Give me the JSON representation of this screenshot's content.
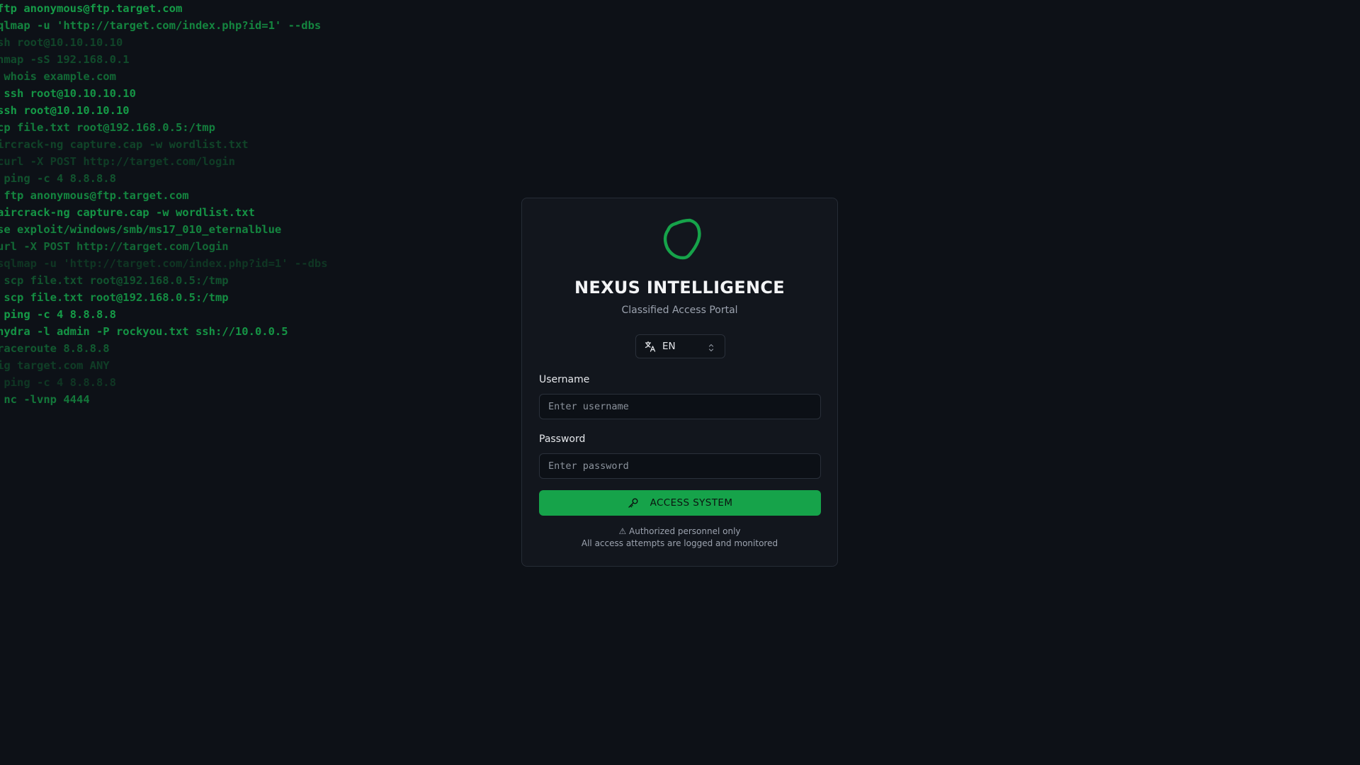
{
  "background_terminal": {
    "lines": [
      {
        "text": "ftp anonymous@ftp.target.com",
        "opacity": 0.95
      },
      {
        "text": "qlmap -u 'http://target.com/index.php?id=1' --dbs",
        "opacity": 0.8
      },
      {
        "text": "sh root@10.10.10.10",
        "opacity": 0.35
      },
      {
        "text": "nmap -sS 192.168.0.1",
        "opacity": 0.4
      },
      {
        "text": " whois example.com",
        "opacity": 0.6
      },
      {
        "text": " ssh root@10.10.10.10",
        "opacity": 0.9
      },
      {
        "text": "ssh root@10.10.10.10",
        "opacity": 0.95
      },
      {
        "text": "cp file.txt root@192.168.0.5:/tmp",
        "opacity": 0.75
      },
      {
        "text": "ircrack-ng capture.cap -w wordlist.txt",
        "opacity": 0.35
      },
      {
        "text": "curl -X POST http://target.com/login",
        "opacity": 0.3
      },
      {
        "text": " ping -c 4 8.8.8.8",
        "opacity": 0.45
      },
      {
        "text": " ftp anonymous@ftp.target.com",
        "opacity": 0.8
      },
      {
        "text": "aircrack-ng capture.cap -w wordlist.txt",
        "opacity": 0.9
      },
      {
        "text": "se exploit/windows/smb/ms17_010_eternalblue",
        "opacity": 0.8
      },
      {
        "text": "url -X POST http://target.com/login",
        "opacity": 0.6
      },
      {
        "text": "sqlmap -u 'http://target.com/index.php?id=1' --dbs",
        "opacity": 0.25
      },
      {
        "text": " scp file.txt root@192.168.0.5:/tmp",
        "opacity": 0.45
      },
      {
        "text": " scp file.txt root@192.168.0.5:/tmp",
        "opacity": 0.85
      },
      {
        "text": " ping -c 4 8.8.8.8",
        "opacity": 0.95
      },
      {
        "text": "hydra -l admin -P rockyou.txt ssh://10.0.0.5",
        "opacity": 0.9
      },
      {
        "text": "raceroute 8.8.8.8",
        "opacity": 0.5
      },
      {
        "text": "ig target.com ANY",
        "opacity": 0.3
      },
      {
        "text": " ping -c 4 8.8.8.8",
        "opacity": 0.25
      },
      {
        "text": " nc -lvnp 4444",
        "opacity": 0.7
      }
    ]
  },
  "login_card": {
    "logo_icon": "shield-icon",
    "title": "NEXUS INTELLIGENCE",
    "subtitle": "Classified Access Portal",
    "language_selector": {
      "icon": "translate-icon",
      "value": "EN",
      "indicator_icon": "chevron-up-down-icon"
    },
    "username": {
      "label": "Username",
      "placeholder": "Enter username",
      "value": ""
    },
    "password": {
      "label": "Password",
      "placeholder": "Enter password",
      "value": ""
    },
    "submit": {
      "icon": "key-icon",
      "label": "ACCESS SYSTEM"
    },
    "footer": {
      "line1": "⚠ Authorized personnel only",
      "line2": "All access attempts are logged and monitored"
    }
  },
  "colors": {
    "background": "#0d1117",
    "card_background": "#12161d",
    "accent": "#16a34a",
    "terminal_text": "#16a34a"
  }
}
